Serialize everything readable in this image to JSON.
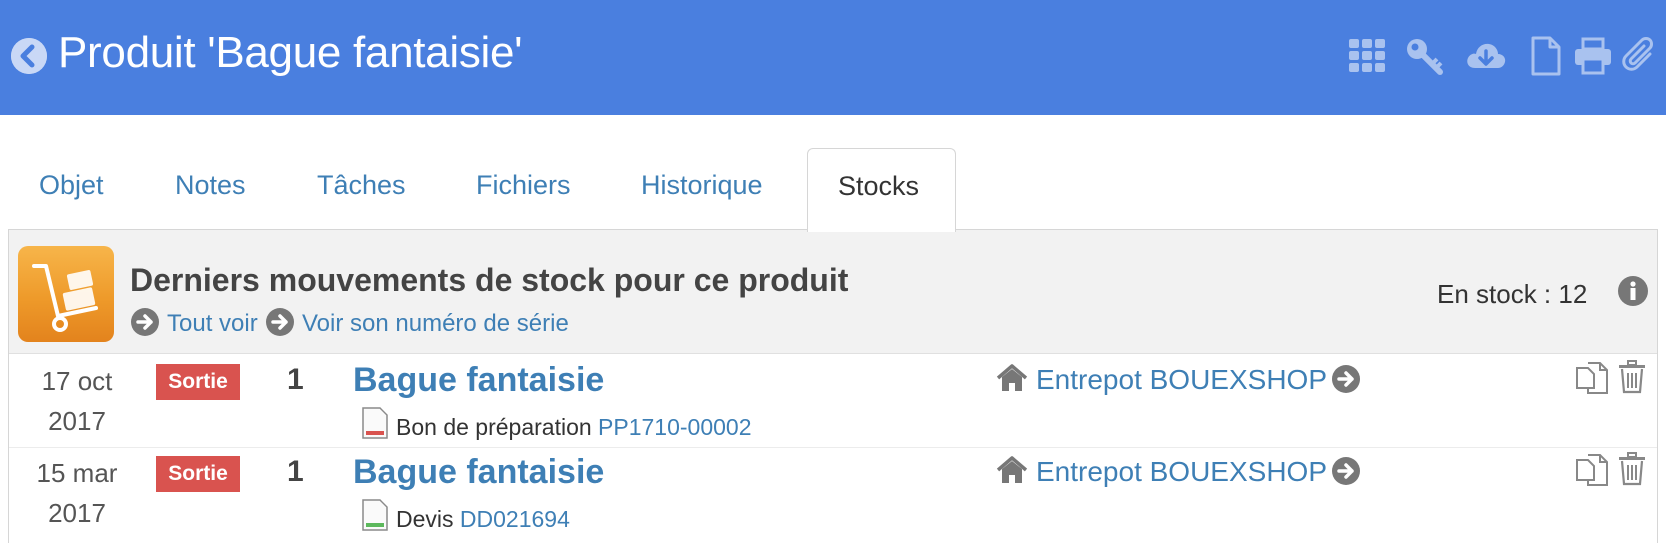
{
  "header": {
    "title": "Produit 'Bague fantaisie'",
    "icons": [
      "back-icon",
      "grid-icon",
      "key-icon",
      "cloud-download-icon",
      "document-icon",
      "print-icon",
      "paperclip-icon"
    ],
    "background_color": "#4a7fdf"
  },
  "tabs": [
    {
      "label": "Objet",
      "active": false
    },
    {
      "label": "Notes",
      "active": false
    },
    {
      "label": "Tâches",
      "active": false
    },
    {
      "label": "Fichiers",
      "active": false
    },
    {
      "label": "Historique",
      "active": false
    },
    {
      "label": "Stocks",
      "active": true
    }
  ],
  "panel": {
    "title": "Derniers mouvements de stock pour ce produit",
    "links": [
      "Tout voir",
      "Voir son numéro de série"
    ],
    "stock_label": "En stock : 12",
    "icon": "stock-cart-icon"
  },
  "movements": [
    {
      "date_line1": "17 oct",
      "date_line2": "2017",
      "type": "Sortie",
      "quantity": "1",
      "product": "Bague fantaisie",
      "doc_type": "Bon de préparation",
      "doc_ref": "PP1710-00002",
      "doc_color": "#d9534f",
      "warehouse": "Entrepot BOUEXSHOP"
    },
    {
      "date_line1": "15 mar",
      "date_line2": "2017",
      "type": "Sortie",
      "quantity": "1",
      "product": "Bague fantaisie",
      "doc_type": "Devis",
      "doc_ref": "DD021694",
      "doc_color": "#5cb85c",
      "warehouse": "Entrepot BOUEXSHOP"
    }
  ],
  "colors": {
    "link": "#3e7fb5",
    "badge_red": "#d9534f",
    "panel_bg": "#f2f2f2"
  }
}
